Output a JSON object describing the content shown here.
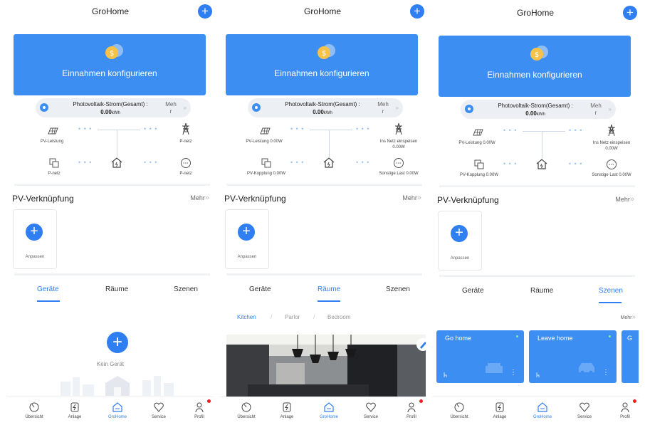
{
  "app_title": "GroHome",
  "add_icon": "plus-icon",
  "banner": {
    "text": "Einnahmen konfigurieren",
    "icon": "coin-icon"
  },
  "pv_summary": {
    "title": "Photovoltaik-Strom(Gesamt) :",
    "value": "0.00",
    "unit": "kWh",
    "more_line1": "Meh",
    "more_line2": "r",
    "arrow": "»"
  },
  "flow_panel1": {
    "pv": "PV-Leistung",
    "grid_top": "P-netz",
    "coupling": "P-netz",
    "other": "P-netz"
  },
  "flow_panel23": {
    "pv": "PV-Leistung 0.00W",
    "grid_top_line1": "Ins Netz einspeisen",
    "grid_top_line2": "0.00W",
    "coupling": "PV-Kopplung 0.00W",
    "other": "Sonstige Last 0.00W"
  },
  "flow_dots": "• • •",
  "pv_section": {
    "title": "PV-Verknüpfung",
    "more": "Mehr",
    "more_arrow": "»",
    "add_label": "Anpassen"
  },
  "tabs": [
    "Geräte",
    "Räume",
    "Szenen"
  ],
  "empty_devices": "Kein Gerät",
  "rooms": [
    "Kitchen",
    "Parlor",
    "Bedroom"
  ],
  "scenes_more": "Mehr",
  "scenes": [
    "Go home",
    "Leave home",
    "G"
  ],
  "nav": [
    "Übersicht",
    "Anlage",
    "GroHome",
    "Service",
    "Profil"
  ],
  "colors": {
    "accent": "#2f7ef2",
    "banner": "#3d8ef2",
    "badge": "#f21e1e"
  }
}
